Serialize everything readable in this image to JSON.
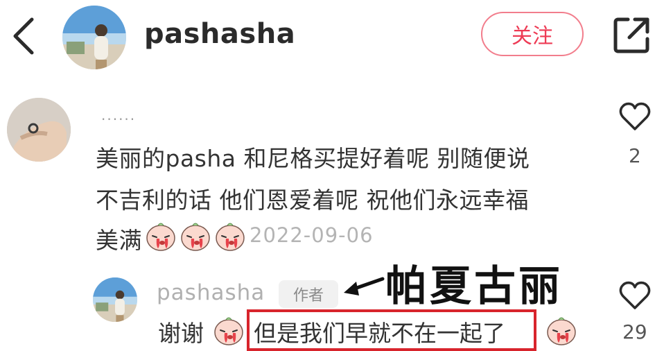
{
  "header": {
    "username": "pashasha",
    "follow_label": "关注"
  },
  "comment": {
    "username": "······",
    "lines": [
      "美丽的pasha 和尼格买提好着呢 别随便说",
      "不吉利的话 他们恩爱着呢  祝他们永远幸福",
      "美满"
    ],
    "date": "2022-09-06",
    "likes": "2"
  },
  "reply": {
    "username": "pashasha",
    "author_badge": "作者",
    "text_a": "谢谢",
    "text_b": "但是我们早就不在一起了",
    "likes": "29"
  },
  "annotation": {
    "text": "帕夏古丽"
  },
  "colors": {
    "follow_text": "#ee3b55",
    "follow_border": "#f27d8c",
    "highlight": "#d8242c"
  },
  "icons": [
    "back-arrow-icon",
    "share-icon",
    "heart-icon",
    "crying-emoji-icon"
  ]
}
